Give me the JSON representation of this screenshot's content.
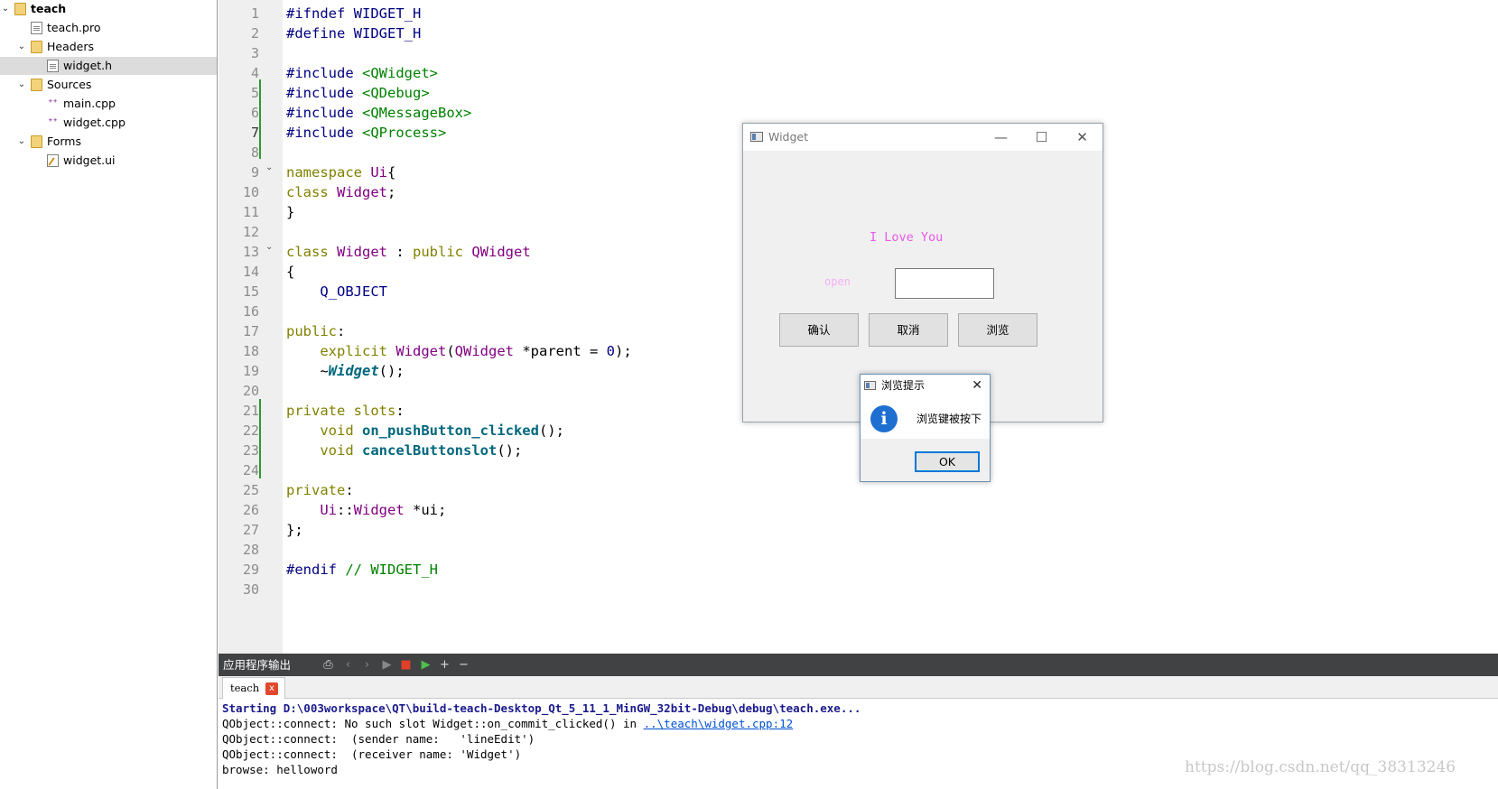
{
  "project_tree": {
    "items": [
      {
        "label": "teach",
        "arrow": "v",
        "level": 0,
        "bold": true
      },
      {
        "label": "teach.pro",
        "arrow": "",
        "level": 1
      },
      {
        "label": "Headers",
        "arrow": "v",
        "level": 1
      },
      {
        "label": "widget.h",
        "arrow": "",
        "level": 2,
        "selected": true
      },
      {
        "label": "Sources",
        "arrow": "v",
        "level": 1
      },
      {
        "label": "main.cpp",
        "arrow": "",
        "level": 2
      },
      {
        "label": "widget.cpp",
        "arrow": "",
        "level": 2
      },
      {
        "label": "Forms",
        "arrow": "v",
        "level": 1
      },
      {
        "label": "widget.ui",
        "arrow": "",
        "level": 2
      }
    ]
  },
  "editor": {
    "current_line": 7,
    "lines": [
      [
        [
          "pp",
          "#ifndef WIDGET_H"
        ]
      ],
      [
        [
          "pp",
          "#define WIDGET_H"
        ]
      ],
      [],
      [
        [
          "pp",
          "#include "
        ],
        [
          "inc",
          "<QWidget>"
        ]
      ],
      [
        [
          "pp",
          "#include "
        ],
        [
          "inc",
          "<QDebug>"
        ]
      ],
      [
        [
          "pp",
          "#include "
        ],
        [
          "inc",
          "<QMessageBox>"
        ]
      ],
      [
        [
          "pp",
          "#include "
        ],
        [
          "inc",
          "<QProcess>"
        ]
      ],
      [],
      [
        [
          "kw",
          "namespace "
        ],
        [
          "ty",
          "Ui"
        ],
        [
          "",
          "{"
        ]
      ],
      [
        [
          "kw",
          "class "
        ],
        [
          "ty",
          "Widget"
        ],
        [
          "",
          ";"
        ]
      ],
      [
        [
          "",
          "}"
        ]
      ],
      [],
      [
        [
          "kw",
          "class "
        ],
        [
          "ty",
          "Widget"
        ],
        [
          "",
          " : "
        ],
        [
          "kw",
          "public "
        ],
        [
          "ty",
          "QWidget"
        ]
      ],
      [
        [
          "",
          "{"
        ]
      ],
      [
        [
          "mac",
          "    Q_OBJECT"
        ]
      ],
      [],
      [
        [
          "kw",
          "public"
        ],
        [
          "",
          ":"
        ]
      ],
      [
        [
          "kw",
          "    explicit "
        ],
        [
          "ty",
          "Widget"
        ],
        [
          "",
          "("
        ],
        [
          "ty",
          "QWidget"
        ],
        [
          "",
          " *parent = "
        ],
        [
          "num",
          "0"
        ],
        [
          "",
          ");"
        ]
      ],
      [
        [
          "",
          "    ~"
        ],
        [
          "fni",
          "Widget"
        ],
        [
          "",
          "();"
        ]
      ],
      [],
      [
        [
          "kw",
          "private slots"
        ],
        [
          "",
          ":"
        ]
      ],
      [
        [
          "kw",
          "    void "
        ],
        [
          "fn",
          "on_pushButton_clicked"
        ],
        [
          "",
          "();"
        ]
      ],
      [
        [
          "kw",
          "    void "
        ],
        [
          "fn",
          "cancelButtonslot"
        ],
        [
          "",
          "();"
        ]
      ],
      [],
      [
        [
          "kw",
          "private"
        ],
        [
          "",
          ":"
        ]
      ],
      [
        [
          "ty",
          "    Ui"
        ],
        [
          "",
          "::"
        ],
        [
          "ty",
          "Widget"
        ],
        [
          "",
          " *ui;"
        ]
      ],
      [
        [
          "",
          "};"
        ]
      ],
      [],
      [
        [
          "pp",
          "#endif "
        ],
        [
          "cmt",
          "// WIDGET_H"
        ]
      ],
      []
    ]
  },
  "output": {
    "title": "应用程序输出",
    "tab_label": "teach",
    "tab_close": "x",
    "buttons": [
      "⎙",
      "‹",
      "›",
      "▶",
      "■",
      "▶",
      "+",
      "−"
    ],
    "lines": [
      {
        "text": "Starting D:\\003workspace\\QT\\build-teach-Desktop_Qt_5_11_1_MinGW_32bit-Debug\\debug\\teach.exe...",
        "kind": "start"
      },
      {
        "text": "QObject::connect: No such slot Widget::on_commit_clicked() in ",
        "link": "..\\teach\\widget.cpp:12"
      },
      {
        "text": "QObject::connect:  (sender name:   'lineEdit')"
      },
      {
        "text": "QObject::connect:  (receiver name: 'Widget')"
      },
      {
        "text": "browse: helloword"
      }
    ],
    "watermark": "https://blog.csdn.net/qq_38313246"
  },
  "widget_window": {
    "title": "Widget",
    "minimize": "—",
    "maximize": "☐",
    "close": "✕",
    "love_label": "I Love You",
    "open_label": "open",
    "line_edit_value": "",
    "confirm_button": "确认",
    "cancel_button": "取消",
    "browse_button": "浏览"
  },
  "message_box": {
    "title": "浏览提示",
    "close": "✕",
    "icon": "i",
    "text": "浏览键被按下",
    "ok_button": "OK"
  }
}
